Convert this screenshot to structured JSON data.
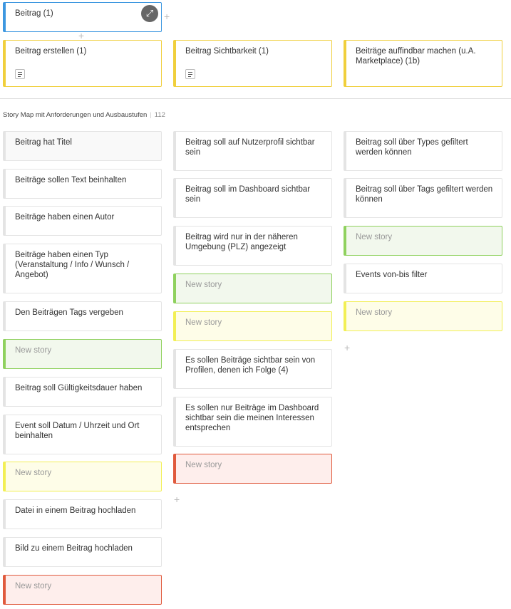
{
  "epic": {
    "label": "Beitrag (1)"
  },
  "features": [
    {
      "label": "Beitrag erstellen (1)"
    },
    {
      "label": "Beitrag Sichtbarkeit (1)"
    },
    {
      "label": "Beiträge auffindbar machen (u.A. Marketplace) (1b)"
    }
  ],
  "section": {
    "title": "Story Map mit Anforderungen und Ausbaustufen",
    "count": "112"
  },
  "columns": [
    {
      "stories": [
        {
          "text": "Beitrag hat Titel",
          "state": "normal"
        },
        {
          "text": "Beiträge sollen Text beinhalten",
          "state": "normal"
        },
        {
          "text": "Beiträge haben einen Autor",
          "state": "normal"
        },
        {
          "text": "Beiträge haben einen Typ (Veranstaltung / Info / Wunsch / Angebot)",
          "state": "normal"
        },
        {
          "text": "Den Beiträgen Tags vergeben",
          "state": "normal"
        },
        {
          "text": "New story",
          "state": "green"
        },
        {
          "text": "Beitrag soll Gültigkeitsdauer haben",
          "state": "normal"
        },
        {
          "text": "Event soll Datum / Uhrzeit und Ort beinhalten",
          "state": "normal"
        },
        {
          "text": "New story",
          "state": "yellow"
        },
        {
          "text": "Datei in einem Beitrag hochladen",
          "state": "normal"
        },
        {
          "text": "Bild zu einem Beitrag hochladen",
          "state": "normal"
        },
        {
          "text": "New story",
          "state": "red"
        }
      ]
    },
    {
      "stories": [
        {
          "text": "Beitrag soll auf Nutzerprofil sichtbar sein",
          "state": "normal"
        },
        {
          "text": "Beitrag soll im Dashboard sichtbar sein",
          "state": "normal"
        },
        {
          "text": "Beitrag wird nur in der näheren Umgebung (PLZ) angezeigt",
          "state": "normal"
        },
        {
          "text": "New story",
          "state": "green"
        },
        {
          "text": "New story",
          "state": "yellow"
        },
        {
          "text": "Es sollen Beiträge sichtbar sein von Profilen, denen ich Folge (4)",
          "state": "normal"
        },
        {
          "text": "Es sollen nur Beiträge im Dashboard sichtbar sein die meinen Interessen entsprechen",
          "state": "normal"
        },
        {
          "text": "New story",
          "state": "red"
        }
      ]
    },
    {
      "stories": [
        {
          "text": "Beitrag soll über Types gefiltert werden können",
          "state": "normal"
        },
        {
          "text": "Beitrag soll über Tags gefiltert werden können",
          "state": "normal"
        },
        {
          "text": "New story",
          "state": "green"
        },
        {
          "text": "Events von-bis filter",
          "state": "normal"
        },
        {
          "text": "New story",
          "state": "yellow"
        }
      ]
    }
  ],
  "colors": {
    "epic": "#3d97e0",
    "feature": "#f0cf3c",
    "green": "#8fd15e",
    "yellow": "#f2ef55",
    "red": "#e05a3d"
  },
  "icons": {
    "expand": "expand-arrows-icon",
    "add": "plus-icon",
    "notes": "document-icon"
  }
}
